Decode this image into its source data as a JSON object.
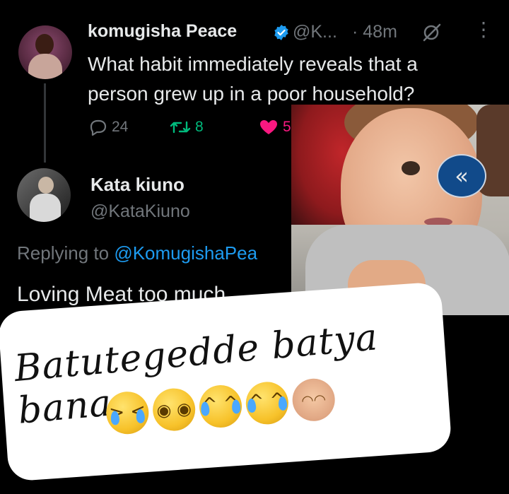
{
  "tweet": {
    "author_name": "komugisha Peace",
    "handle": "@K...",
    "time": "· 48m",
    "text": "What habit immediately reveals that a person grew up in a poor household?",
    "replies": "24",
    "retweets": "8",
    "likes": "5"
  },
  "reply": {
    "author_name": "Kata kiuno",
    "handle": "@KataKiuno",
    "replying_label": "Replying to",
    "replying_mention": "@KomugishaPea",
    "text": "Loving Meat too much."
  },
  "overlay": {
    "collapse_symbol": "«"
  },
  "caption": {
    "text": "Batutegedde batya banae",
    "emojis": [
      "crying-face",
      "pleading-face",
      "tears-of-joy-face",
      "tears-of-joy-face",
      "person-gesturing-ok"
    ]
  },
  "colors": {
    "background": "#000000",
    "retweet": "#00ba7c",
    "like": "#f91880",
    "link": "#1d9bf0",
    "muted": "#71767b",
    "verified": "#1d9bf0"
  }
}
